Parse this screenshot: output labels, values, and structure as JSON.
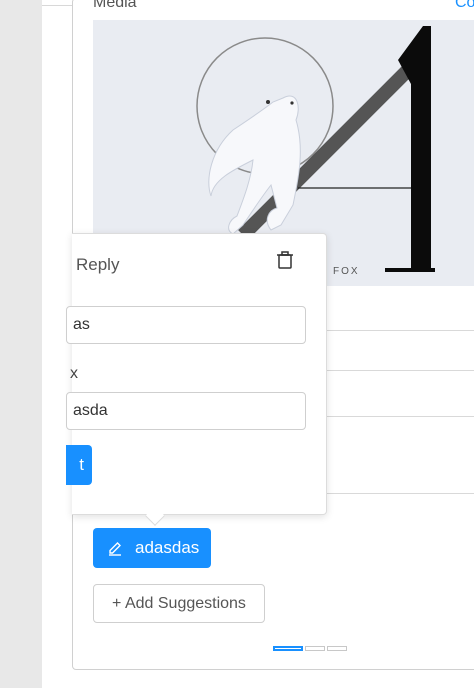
{
  "header": {
    "media_label": "Media",
    "corner_link": "Co"
  },
  "media": {
    "brand_text": "FOX"
  },
  "reply_popover": {
    "title": "Reply",
    "field1_value": "as",
    "field2_label": "x",
    "field2_value": "asda",
    "submit_label": "t"
  },
  "tag": {
    "label": "adasdas"
  },
  "add_suggestions": {
    "label": "+ Add Suggestions"
  },
  "carousel": {
    "count": 3,
    "active_index": 0
  },
  "colors": {
    "accent": "#1890ff",
    "border": "#d0d0d0",
    "media_bg": "#e9ecf2"
  },
  "icons": [
    "delete-icon",
    "edit-icon"
  ]
}
